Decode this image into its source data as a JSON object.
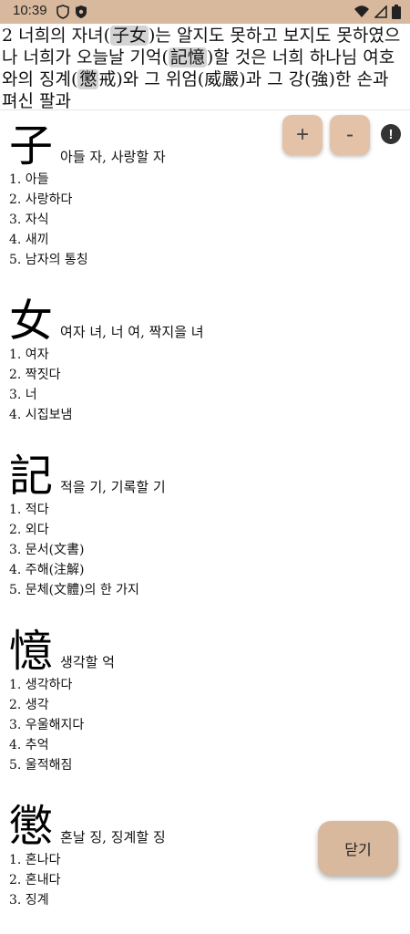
{
  "status_bar": {
    "time": "10:39"
  },
  "verse": {
    "number": "2",
    "seg1": "너희의 자녀(",
    "hl1": "子女",
    "seg2": ")는 알지도 못하고 보지도 못하였으나 너희가 오늘날 기억(",
    "hl2": "記憶",
    "seg3": ")할 것은 너희 하나님 여호와의 징계(",
    "hl3": "懲",
    "seg4": "戒)와 그 위엄(威嚴)과 그 강(強)한 손과 펴신 팔과"
  },
  "controls": {
    "plus": "+",
    "minus": "-",
    "info": "!"
  },
  "entries": [
    {
      "hanja": "子",
      "reading": "아들 자, 사랑할 자",
      "meanings": [
        "1. 아들",
        "2. 사랑하다",
        "3. 자식",
        "4. 새끼",
        "5. 남자의 통칭"
      ]
    },
    {
      "hanja": "女",
      "reading": "여자 녀, 너 여, 짝지을 녀",
      "meanings": [
        "1. 여자",
        "2. 짝짓다",
        "3. 너",
        "4. 시집보냄"
      ]
    },
    {
      "hanja": "記",
      "reading": "적을 기, 기록할 기",
      "meanings": [
        "1. 적다",
        "2. 외다",
        "3. 문서(文書)",
        "4. 주해(注解)",
        "5. 문체(文體)의 한 가지"
      ]
    },
    {
      "hanja": "憶",
      "reading": "생각할 억",
      "meanings": [
        "1. 생각하다",
        "2. 생각",
        "3. 우울해지다",
        "4. 추억",
        "5. 울적해짐"
      ]
    },
    {
      "hanja": "懲",
      "reading": "혼날 징, 징계할 징",
      "meanings": [
        "1. 혼나다",
        "2. 혼내다",
        "3. 징계"
      ]
    }
  ],
  "close_button": {
    "label": "닫기"
  }
}
